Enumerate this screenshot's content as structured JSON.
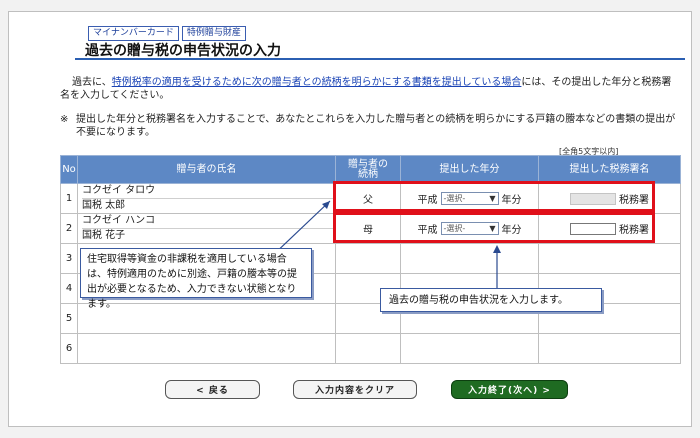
{
  "tags": [
    "マイナンバーカード",
    "特例贈与財産"
  ],
  "title": "過去の贈与税の申告状況の入力",
  "intro": {
    "before": "過去に、",
    "link": "特例税率の適用を受けるために次の贈与者との続柄を明らかにする書類を提出している場合",
    "after": "には、その提出した年分と税務署名を入力してください。"
  },
  "note": {
    "mark": "※",
    "text": "提出した年分と税務署名を入力することで、あなたとこれらを入力した贈与者との続柄を明らかにする戸籍の謄本などの書類の提出が不要になります。"
  },
  "char_limit_note": "[全角5文字以内]",
  "table": {
    "headers": {
      "no": "No",
      "name": "贈与者の氏名",
      "relation": "贈与者の続柄",
      "year": "提出した年分",
      "office": "提出した税務署名"
    },
    "rows": [
      {
        "no": "1",
        "kana": "コクゼイ タロウ",
        "kanji": "国税 太郎",
        "relation": "父",
        "era": "平成",
        "select": "-選択-",
        "year_unit": "年分",
        "office_suffix": "税務署"
      },
      {
        "no": "2",
        "kana": "コクゼイ ハンコ",
        "kanji": "国税 花子",
        "relation": "母",
        "era": "平成",
        "select": "-選択-",
        "year_unit": "年分",
        "office_suffix": "税務署"
      },
      {
        "no": "3"
      },
      {
        "no": "4"
      },
      {
        "no": "5"
      },
      {
        "no": "6"
      }
    ]
  },
  "callouts": {
    "left": "住宅取得等資金の非課税を適用している場合は、特例適用のために別途、戸籍の謄本等の提出が必要となるため、入力できない状態となります。",
    "right": "過去の贈与税の申告状況を入力します。"
  },
  "buttons": {
    "back": "< 戻る",
    "clear": "入力内容をクリア",
    "done": "入力終了(次へ) >"
  },
  "colors": {
    "header_bg": "#5d88c5",
    "highlight": "#e0101a",
    "link": "#1a43b5",
    "done_button": "#1f6b22"
  }
}
